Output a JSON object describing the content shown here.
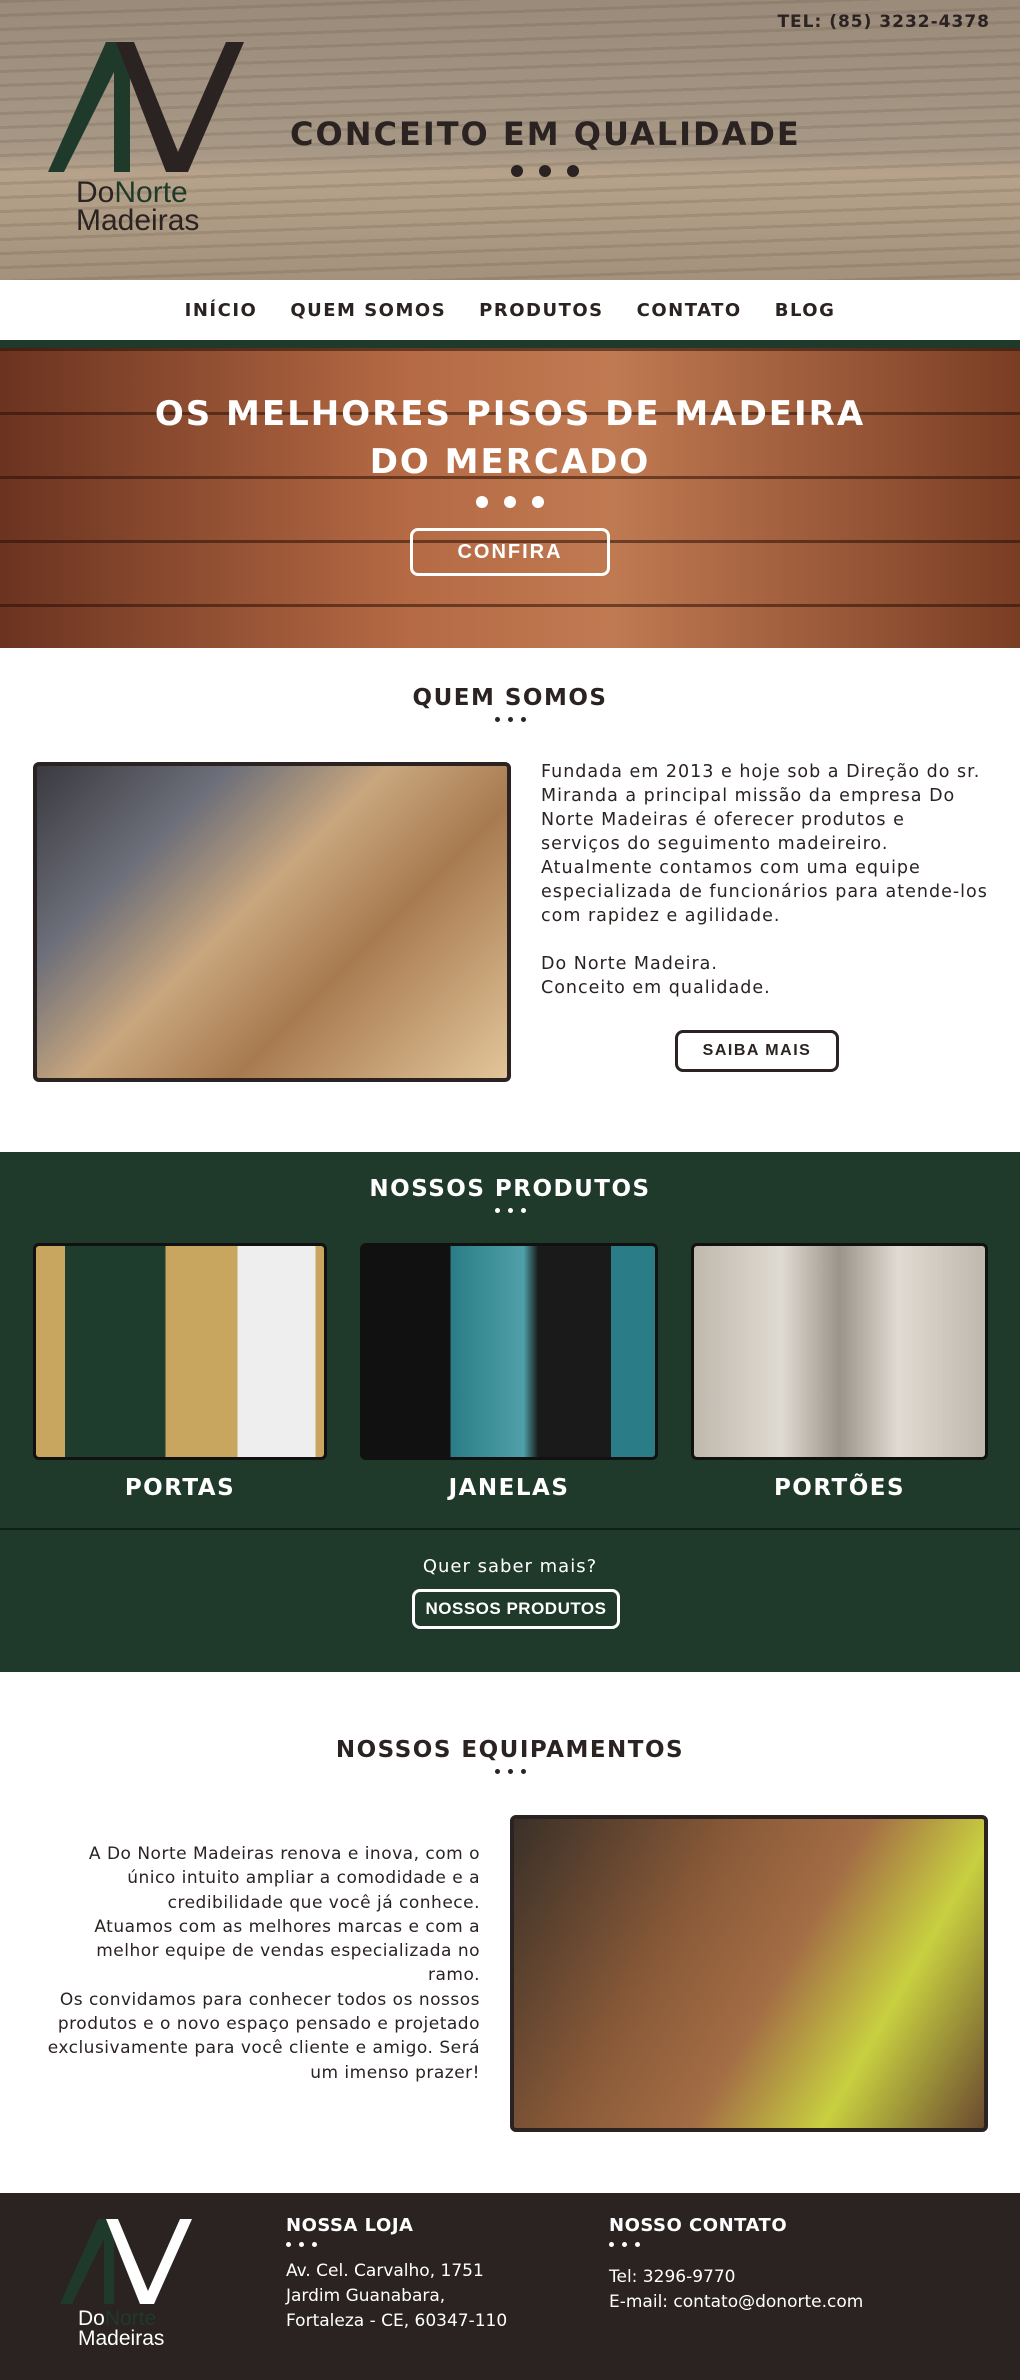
{
  "header": {
    "phone": "TEL: (85) 3232-4378",
    "tagline": "CONCEITO EM QUALIDADE",
    "logo_text": [
      "Do",
      "Norte",
      "Madeiras"
    ]
  },
  "nav": {
    "items": [
      "INÍCIO",
      "QUEM SOMOS",
      "PRODUTOS",
      "CONTATO",
      "BLOG"
    ]
  },
  "hero": {
    "title_line1": "OS MELHORES PISOS DE MADEIRA",
    "title_line2": "DO MERCADO",
    "button": "CONFIRA"
  },
  "about": {
    "title": "QUEM SOMOS",
    "paragraph": "Fundada em 2013 e hoje sob a Direção do sr. Miranda a principal missão da empresa Do Norte Madeiras é oferecer produtos e serviços do seguimento madeireiro. Atualmente contamos com uma equipe especializada de funcionários para atende-los com rapidez e agilidade.",
    "sign1": "Do Norte Madeira.",
    "sign2": "Conceito em qualidade.",
    "button": "SAIBA MAIS"
  },
  "products": {
    "title": "NOSSOS PRODUTOS",
    "items": [
      {
        "label": "PORTAS"
      },
      {
        "label": "JANELAS"
      },
      {
        "label": "PORTÕES"
      }
    ],
    "more_text": "Quer saber mais?",
    "button": "NOSSOS PRODUTOS"
  },
  "equipment": {
    "title": "NOSSOS EQUIPAMENTOS",
    "p1": "A Do Norte Madeiras renova e inova, com o único intuito ampliar a comodidade e a credibilidade que você já conhece.",
    "p2": "Atuamos com as melhores marcas e com a melhor equipe de vendas especializada no ramo.",
    "p3": "Os convidamos para conhecer todos os nossos produtos e o novo espaço pensado e projetado exclusivamente para você cliente e amigo. Será um imenso prazer!"
  },
  "footer": {
    "store_title": "NOSSA LOJA",
    "address": [
      "Av. Cel. Carvalho, 1751",
      "Jardim Guanabara,",
      "Fortaleza - CE, 60347-110"
    ],
    "contact_title": "NOSSO CONTATO",
    "phone": "Tel: 3296-9770",
    "email": "E-mail: contato@donorte.com"
  },
  "colors": {
    "brand_green": "#1f3a2a",
    "dark_brown": "#2b2222"
  }
}
